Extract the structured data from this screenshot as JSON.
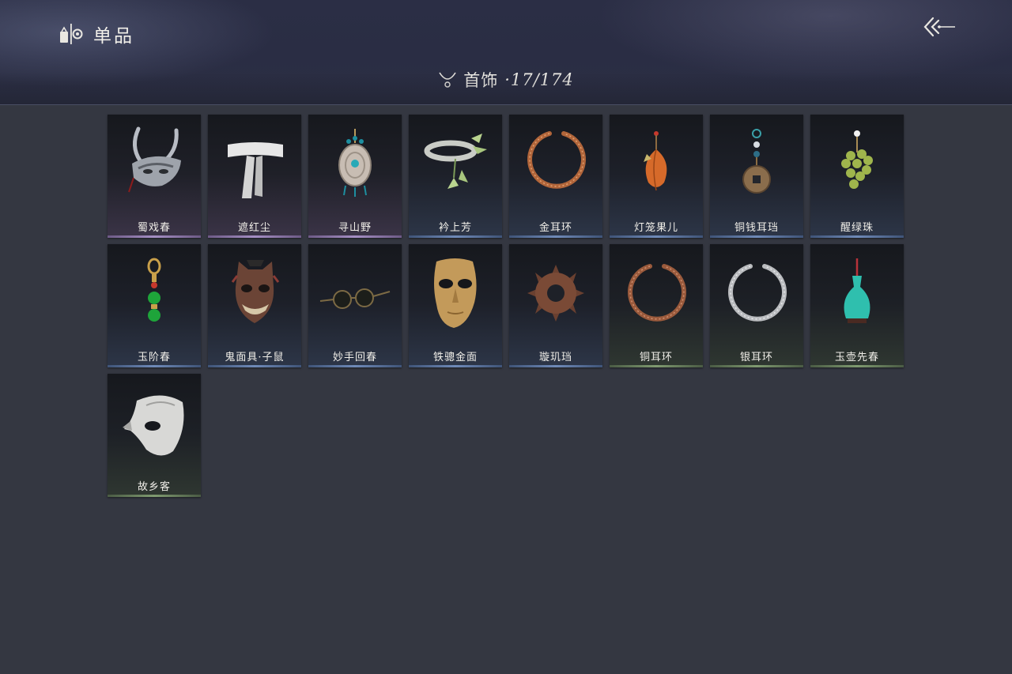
{
  "header": {
    "title": "单品",
    "title_icon": "wardrobe-icon",
    "back_icon": "back-arrow-icon",
    "category": {
      "icon": "necklace-icon",
      "label": "首饰",
      "count": "·17/174"
    }
  },
  "items": [
    {
      "name": "蜀戏春",
      "icon": "silver-horned-mask",
      "rarity": "purple"
    },
    {
      "name": "遮红尘",
      "icon": "white-headband",
      "rarity": "purple"
    },
    {
      "name": "寻山野",
      "icon": "silver-pendant",
      "rarity": "purple"
    },
    {
      "name": "衿上芳",
      "icon": "silver-bangle-with-leaves",
      "rarity": "blue"
    },
    {
      "name": "金耳环",
      "icon": "copper-earring-ring",
      "rarity": "blue"
    },
    {
      "name": "灯笼果儿",
      "icon": "lantern-fruit-earring",
      "rarity": "blue"
    },
    {
      "name": "铜钱耳珰",
      "icon": "coin-earring",
      "rarity": "blue"
    },
    {
      "name": "醒绿珠",
      "icon": "green-grape-hairpin",
      "rarity": "blue"
    },
    {
      "name": "玉阶春",
      "icon": "green-jade-earring",
      "rarity": "blue"
    },
    {
      "name": "鬼面具·子鼠",
      "icon": "demon-rat-mask",
      "rarity": "blue"
    },
    {
      "name": "妙手回春",
      "icon": "round-glasses",
      "rarity": "blue"
    },
    {
      "name": "铁骢金面",
      "icon": "golden-half-mask",
      "rarity": "blue"
    },
    {
      "name": "璇玑珰",
      "icon": "spiked-ring-earring",
      "rarity": "blue"
    },
    {
      "name": "铜耳环",
      "icon": "bronze-earring-ring",
      "rarity": "green"
    },
    {
      "name": "银耳环",
      "icon": "silver-earring-ring",
      "rarity": "green"
    },
    {
      "name": "玉壶先春",
      "icon": "jade-vase-hairpin",
      "rarity": "green"
    },
    {
      "name": "故乡客",
      "icon": "white-bird-mask",
      "rarity": "green"
    }
  ]
}
